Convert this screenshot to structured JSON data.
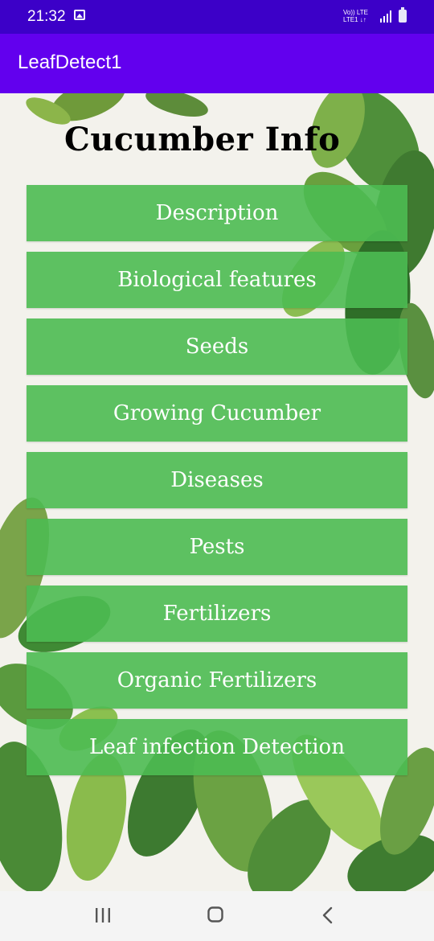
{
  "status_bar": {
    "time": "21:32",
    "network_top": "Vo)) LTE",
    "network_bottom": "LTE1 ↓↑"
  },
  "app_bar": {
    "title": "LeafDetect1"
  },
  "page": {
    "title": "Cucumber Info",
    "menu": [
      {
        "label": "Description"
      },
      {
        "label": "Biological features"
      },
      {
        "label": "Seeds"
      },
      {
        "label": "Growing Cucumber"
      },
      {
        "label": "Diseases"
      },
      {
        "label": "Pests"
      },
      {
        "label": "Fertilizers"
      },
      {
        "label": "Organic Fertilizers"
      },
      {
        "label": "Leaf infection Detection"
      }
    ]
  },
  "colors": {
    "status_bar": "#3c00c8",
    "app_bar": "#6200ee",
    "button": "#4cbb52"
  }
}
